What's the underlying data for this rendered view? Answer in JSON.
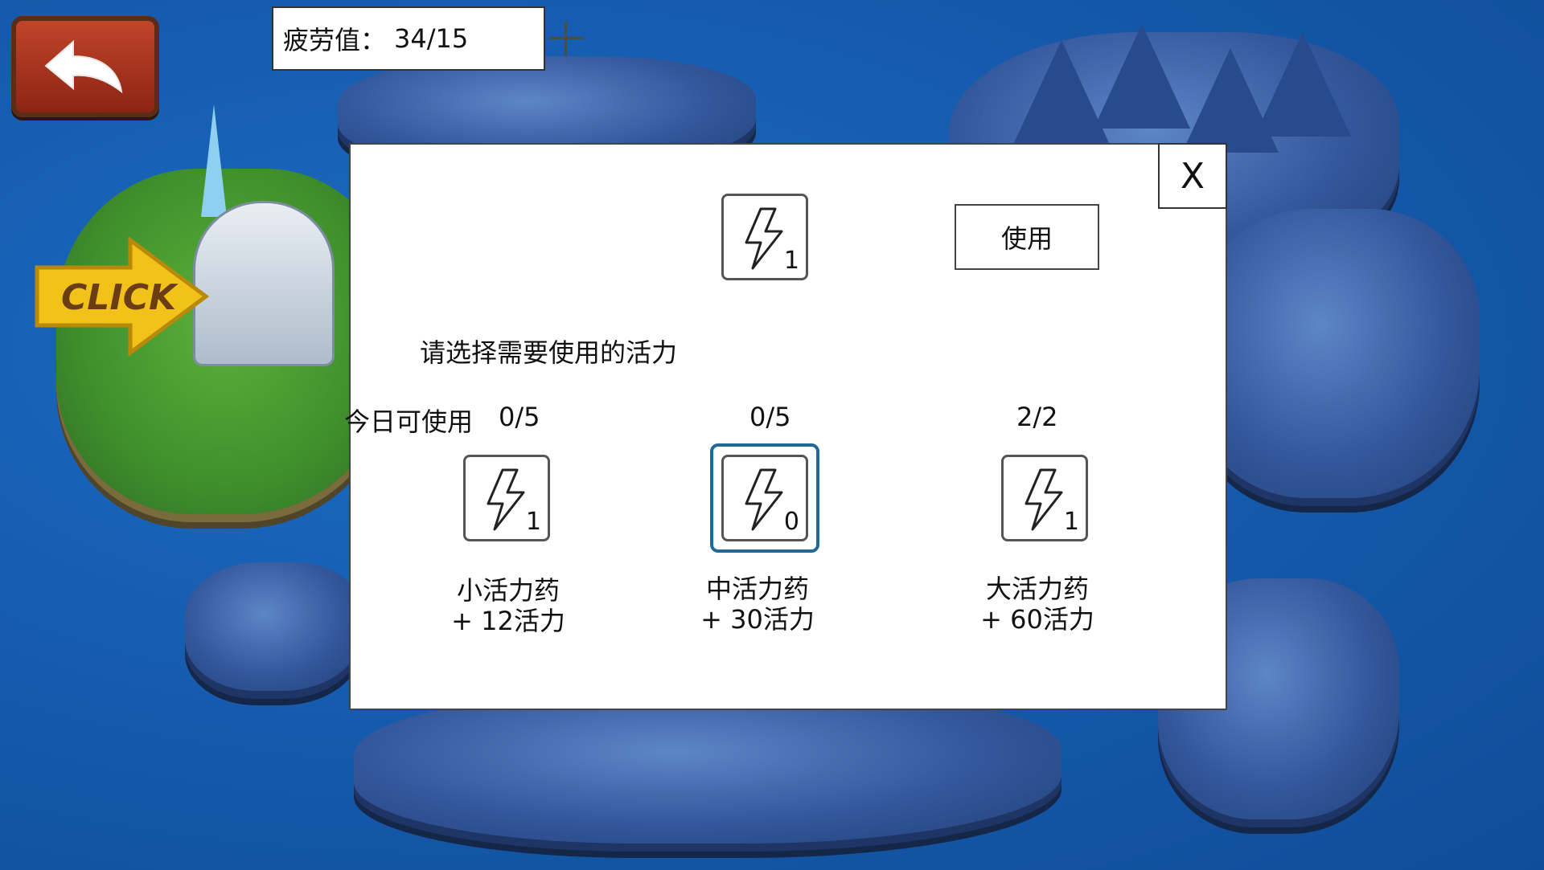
{
  "fatigue": {
    "label": "疲劳值：",
    "value": "34/15"
  },
  "map": {
    "click_label": "CLICK"
  },
  "dialog": {
    "close_label": "X",
    "selected_slot_count": "1",
    "use_label": "使用",
    "prompt": "请选择需要使用的活力",
    "today_label": "今日可使用",
    "potions": [
      {
        "usage": "0/5",
        "count": "1",
        "name": "小活力药",
        "effect": "+ 12活力"
      },
      {
        "usage": "0/5",
        "count": "0",
        "name": "中活力药",
        "effect": "+ 30活力"
      },
      {
        "usage": "2/2",
        "count": "1",
        "name": "大活力药",
        "effect": "+ 60活力"
      }
    ]
  },
  "colors": {
    "sea": "#1560b6",
    "back_button": "#a83420",
    "selected_border": "#1f6a9a",
    "click_arrow": "#f2c21b"
  }
}
